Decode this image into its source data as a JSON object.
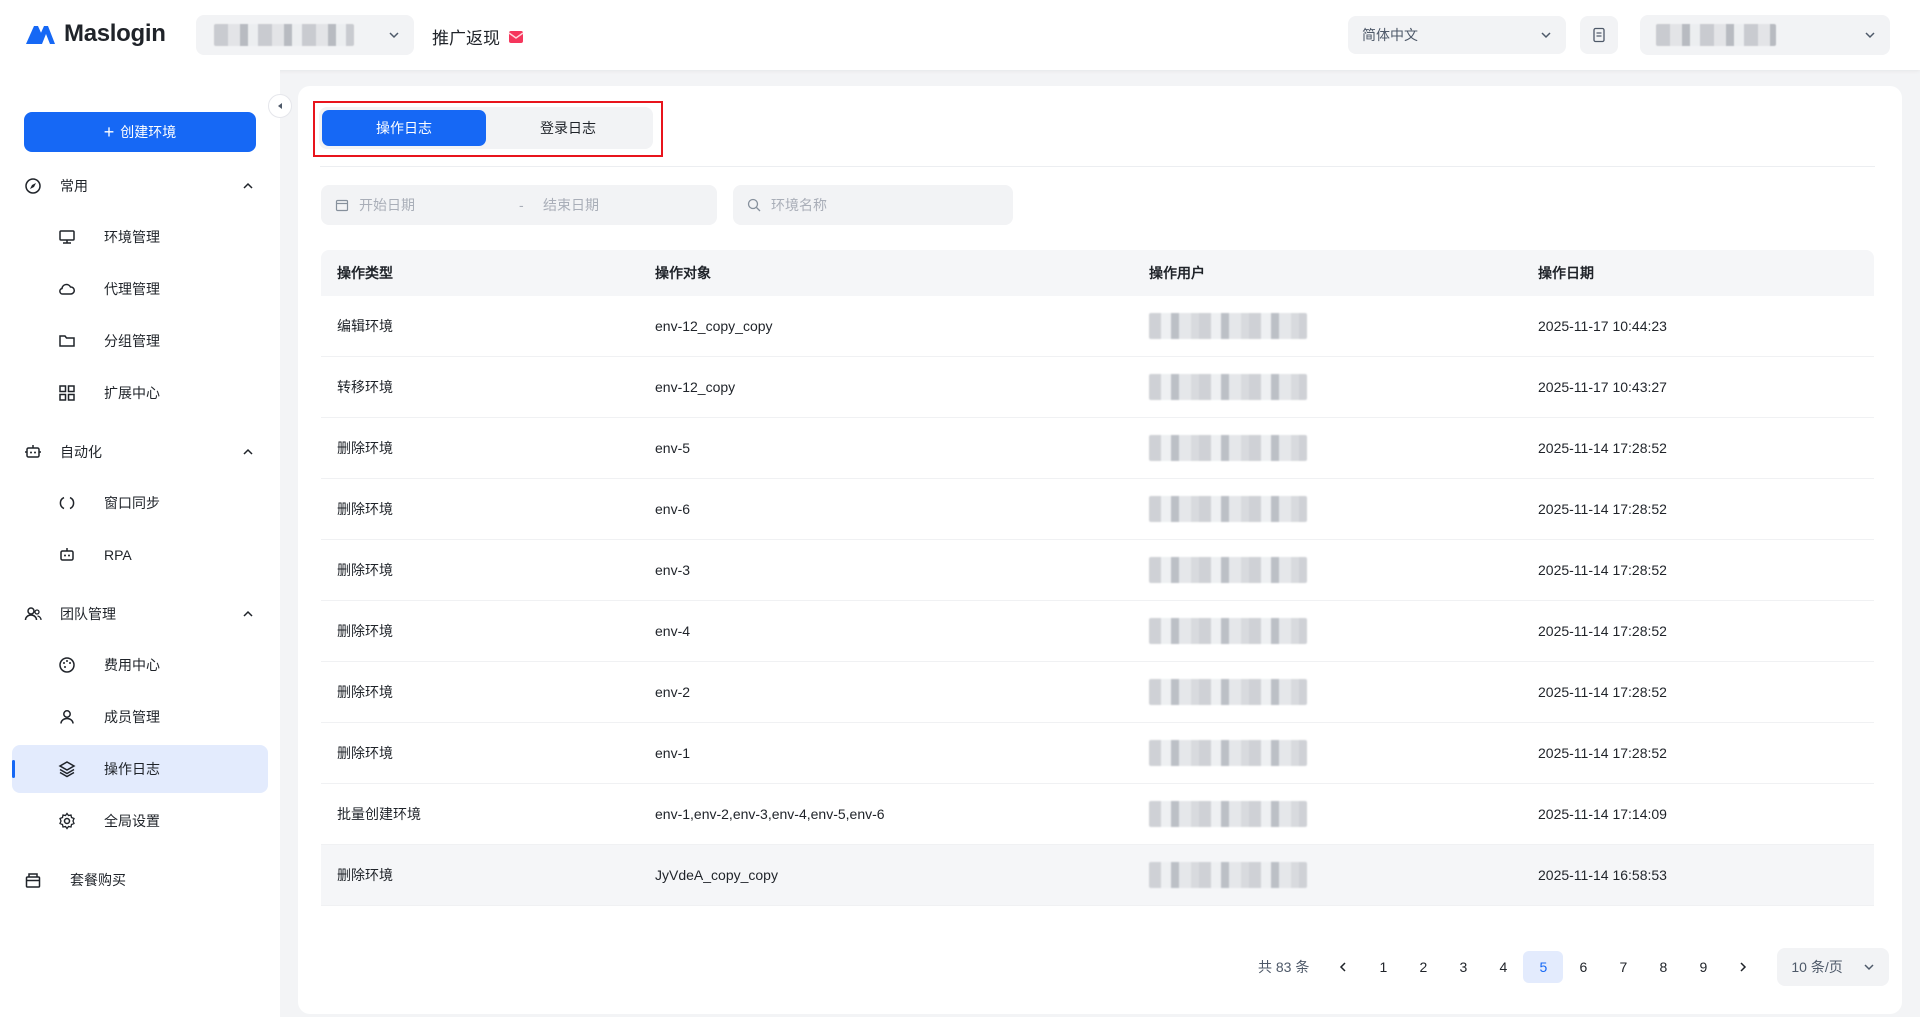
{
  "header": {
    "brand": "Maslogin",
    "promo_label": "推广返现",
    "language": "简体中文"
  },
  "sidebar": {
    "create_button": "创建环境",
    "groups": [
      {
        "label": "常用",
        "items": [
          "环境管理",
          "代理管理",
          "分组管理",
          "扩展中心"
        ]
      },
      {
        "label": "自动化",
        "items": [
          "窗口同步",
          "RPA"
        ]
      },
      {
        "label": "团队管理",
        "items": [
          "费用中心",
          "成员管理",
          "操作日志",
          "全局设置"
        ]
      }
    ],
    "plain_item": "套餐购买",
    "active_item": "操作日志"
  },
  "tabs": [
    {
      "label": "操作日志",
      "active": true
    },
    {
      "label": "登录日志",
      "active": false
    }
  ],
  "filters": {
    "start_placeholder": "开始日期",
    "separator": "-",
    "end_placeholder": "结束日期",
    "search_placeholder": "环境名称"
  },
  "table": {
    "columns": [
      "操作类型",
      "操作对象",
      "操作用户",
      "操作日期"
    ],
    "rows": [
      {
        "type": "编辑环境",
        "target": "env-12_copy_copy",
        "date": "2025-11-17 10:44:23"
      },
      {
        "type": "转移环境",
        "target": "env-12_copy",
        "date": "2025-11-17 10:43:27"
      },
      {
        "type": "删除环境",
        "target": "env-5",
        "date": "2025-11-14 17:28:52"
      },
      {
        "type": "删除环境",
        "target": "env-6",
        "date": "2025-11-14 17:28:52"
      },
      {
        "type": "删除环境",
        "target": "env-3",
        "date": "2025-11-14 17:28:52"
      },
      {
        "type": "删除环境",
        "target": "env-4",
        "date": "2025-11-14 17:28:52"
      },
      {
        "type": "删除环境",
        "target": "env-2",
        "date": "2025-11-14 17:28:52"
      },
      {
        "type": "删除环境",
        "target": "env-1",
        "date": "2025-11-14 17:28:52"
      },
      {
        "type": "批量创建环境",
        "target": "env-1,env-2,env-3,env-4,env-5,env-6",
        "date": "2025-11-14 17:14:09"
      },
      {
        "type": "删除环境",
        "target": "JyVdeA_copy_copy",
        "date": "2025-11-14 16:58:53"
      }
    ]
  },
  "pagination": {
    "total_text": "共 83 条",
    "pages": [
      "1",
      "2",
      "3",
      "4",
      "5",
      "6",
      "7",
      "8",
      "9"
    ],
    "current": "5",
    "page_size": "10 条/页"
  },
  "colors": {
    "primary": "#1668f5",
    "highlight_border": "#e8141c",
    "active_bg": "#e3ebfd"
  }
}
